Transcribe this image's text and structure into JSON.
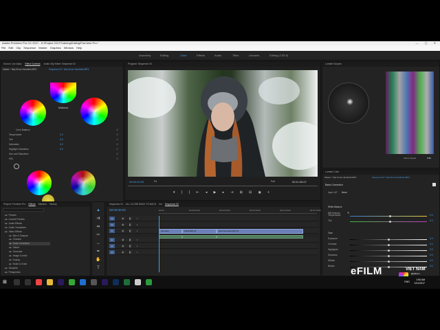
{
  "window": {
    "title": "Adobe Premiere Pro CC 2017 - D:\\Project 2017\\Training\\Editing\\Premiere Pro *",
    "controls": "— ▢ ✕"
  },
  "menu": [
    "File",
    "Edit",
    "Clip",
    "Sequence",
    "Marker",
    "Graphics",
    "Window",
    "Help"
  ],
  "workspaces": [
    {
      "label": "Assembly",
      "active": false
    },
    {
      "label": "Editing",
      "active": false
    },
    {
      "label": "Color",
      "active": true
    },
    {
      "label": "Effects",
      "active": false
    },
    {
      "label": "Audio",
      "active": false
    },
    {
      "label": "Titles",
      "active": false
    },
    {
      "label": "Libraries",
      "active": false
    },
    {
      "label": "Editing (CS5.5)",
      "active": false
    }
  ],
  "effect_controls": {
    "tabs": [
      "Source: (no clips)",
      "Effect Controls",
      "Audio Clip Mixer: Sequence 02"
    ],
    "clip_label": "Master * Islip Snow Handheld.MP4",
    "clip_label_seq": "Sequence 02 * Islip Snow Handheld.MP4",
    "midtones_label": "Midtones",
    "rows": [
      {
        "label": "Color Balance",
        "value": ""
      },
      {
        "label": "Temperature",
        "value": "0.0"
      },
      {
        "label": "Tint",
        "value": "0.0"
      },
      {
        "label": "Saturation",
        "value": "0.0"
      },
      {
        "label": "Highlight Saturation",
        "value": "0.0"
      },
      {
        "label": "Hue and Saturation",
        "value": ""
      },
      {
        "label": "HSL",
        "value": ""
      }
    ],
    "bottom_rows": [
      {
        "label": "Saturation",
        "value": "60.0"
      },
      {
        "label": "Hue",
        "value": "0.0"
      }
    ]
  },
  "program": {
    "title": "Program: Sequence 02",
    "timecode_left": "00:00:00:00",
    "fit": "Fit",
    "full": "Full",
    "timecode_right": "00:11:00:07"
  },
  "lumetri_scopes": {
    "title": "Lumetri Scopes",
    "clamp": "Clamp Signal",
    "bits": "8 Bit"
  },
  "lumetri_color": {
    "title": "Lumetri Color",
    "clip_a": "Master * Islip Snow Handheld.MP4",
    "clip_b": "Sequence 02 * Islip Snow Handheld.MP4",
    "section": "Basic Correction",
    "input_lut_label": "Input LUT",
    "input_lut_value": "None",
    "white_balance_section": "White Balance",
    "wb_selector": "WB Selector",
    "tone_section": "Tone",
    "sliders": [
      {
        "label": "Temperature",
        "value": "0.0",
        "level": 0.52
      },
      {
        "label": "Tint",
        "value": "0.0",
        "level": 0.52
      },
      {
        "label": "Exposure",
        "value": "0.0",
        "level": 0.5
      },
      {
        "label": "Contrast",
        "value": "0.0",
        "level": 0.5
      },
      {
        "label": "Highlights",
        "value": "0.0",
        "level": 0.5
      },
      {
        "label": "Shadows",
        "value": "0.0",
        "level": 0.5
      },
      {
        "label": "Whites",
        "value": "0.0",
        "level": 0.5
      },
      {
        "label": "Blacks",
        "value": "0.0",
        "level": 0.5
      }
    ]
  },
  "project": {
    "tabs": [
      "Project: Premiere Pro",
      "Effects",
      "Markers",
      "History"
    ],
    "items": [
      "Presets",
      "Lumetri Presets",
      "Audio Effects",
      "Audio Transitions",
      "Video Effects",
      "Blur & Sharpen",
      "Channel",
      "Color Correction",
      "Distort",
      "Generate",
      "Image Control",
      "Keying",
      "Noise & Grain",
      "Obsolete",
      "Perspective"
    ]
  },
  "timeline": {
    "tabs": [
      "Sequence 01",
      "ALL CLOSE BACK TO BACK",
      "hrc",
      "Sequence 02"
    ],
    "timecode": "00:00:00:00",
    "ruler": [
      "00:00",
      "00:00:15:00",
      "00:00:30:00",
      "00:00:45:00",
      "00:01:00:00",
      "00:01:15:00"
    ],
    "tracks": [
      "V3",
      "V2",
      "V1",
      "A1",
      "A2",
      "A3"
    ],
    "clips": [
      {
        "label": "Clip Snow",
        "track": 2,
        "start": 0.0,
        "end": 0.16
      },
      {
        "label": "C0131.MP4 [V]",
        "track": 2,
        "start": 0.16,
        "end": 0.4
      },
      {
        "label": "Hear Fire Hands.MP4 [V]",
        "track": 2,
        "start": 0.4,
        "end": 1.0
      }
    ]
  },
  "watermark": {
    "brand": "eFILM",
    "sub": "VIET NAM",
    "handle": "@efilmvn"
  },
  "taskbar": {
    "time": "1:50 AM",
    "date": "12/1/2017",
    "lang": "ENG"
  }
}
